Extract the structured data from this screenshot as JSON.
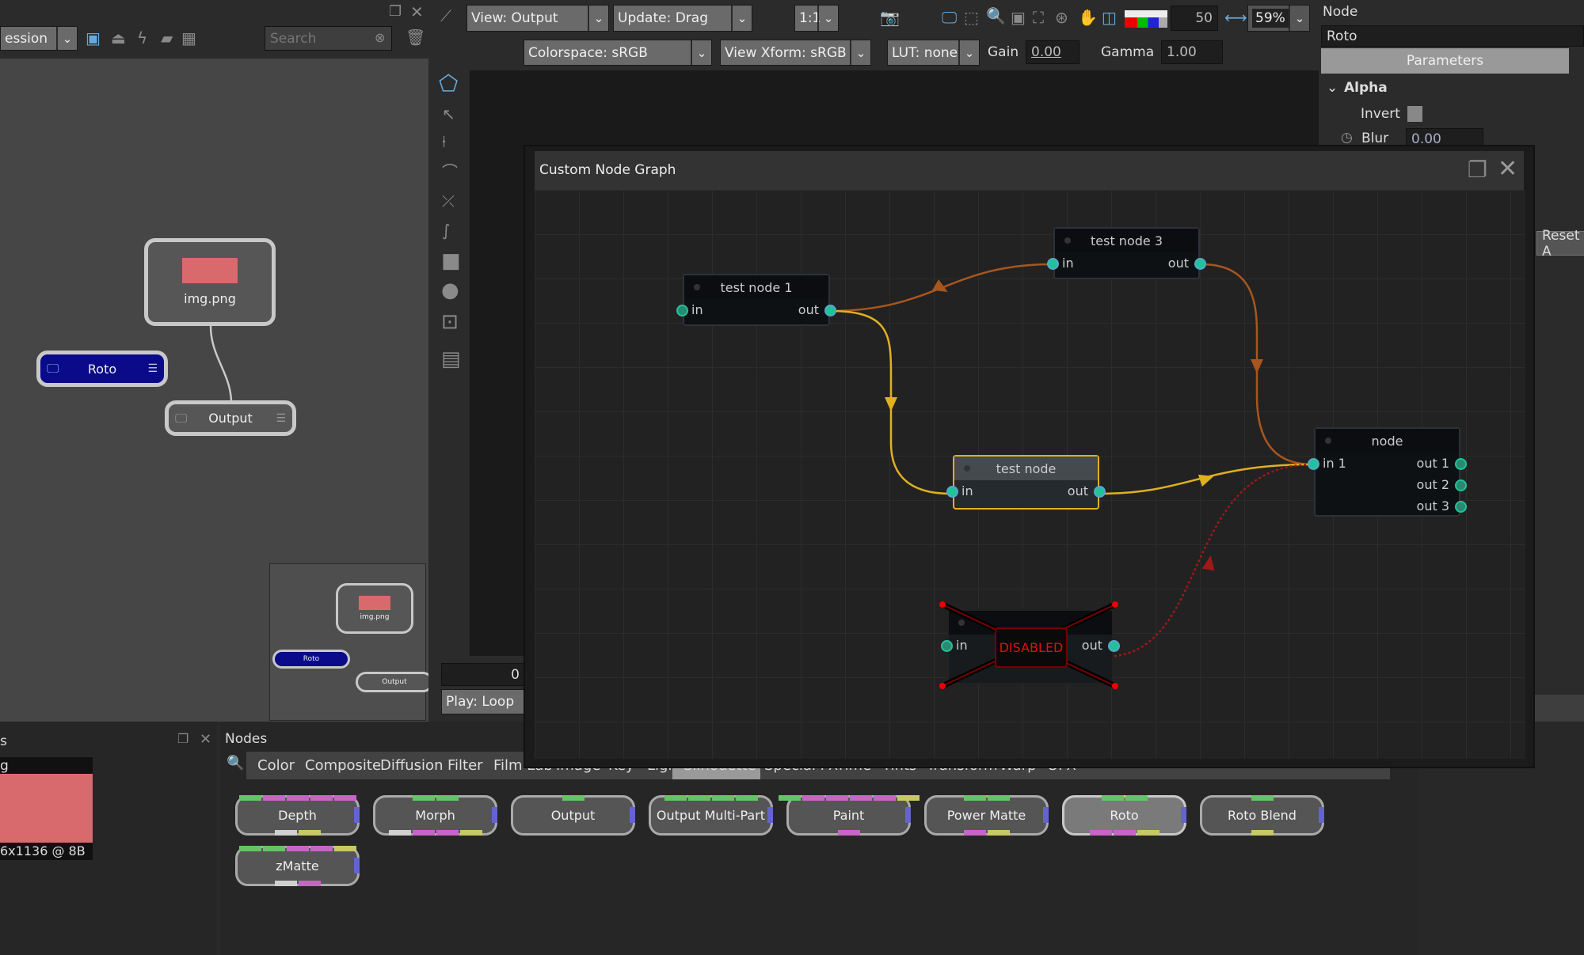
{
  "colors": {
    "accent": "#1fc39a",
    "edge_orange": "#a8561c",
    "edge_yellow": "#e0b020",
    "edge_disabled": "#a01818",
    "roto_node": "#0a0a8a",
    "thumb": "#d86a6e",
    "green": "#64c464",
    "pink": "#c864c8",
    "yellow": "#c8c864",
    "gray": "#aaaaaa",
    "light": "#d0d0d0",
    "blue": "#6464d0"
  },
  "graph_panel": {
    "session": "ession",
    "search_placeholder": "Search",
    "nodes": {
      "img": "img.png",
      "roto": "Roto",
      "output": "Output"
    }
  },
  "viewer": {
    "view": "View: Output",
    "update": "Update: Drag",
    "ratio": "1:1",
    "frame_step": "50",
    "zoom": "59%",
    "colorspace": "Colorspace: sRGB",
    "view_xform": "View Xform: sRGB",
    "lut": "LUT: none",
    "gain_label": "Gain",
    "gain": "0.00",
    "gamma_label": "Gamma",
    "gamma": "1.00",
    "frame": "0",
    "play": "Play: Loop"
  },
  "properties": {
    "title": "Node",
    "node_name": "Roto",
    "tab": "Parameters",
    "section": "Alpha",
    "invert_label": "Invert",
    "blur_label": "Blur",
    "blur": "0.00",
    "reset": "Reset A"
  },
  "image_panel": {
    "title": "s",
    "name": "g",
    "info": "6x1136 @ 8B"
  },
  "nodes_panel": {
    "title": "Nodes",
    "selected_tab": "Silhouette",
    "tabs": [
      "Color",
      "Composite",
      "Diffusion",
      "Filter",
      "Film Lab",
      "Image",
      "Key",
      "Light",
      "Silhouette",
      "Special FX",
      "Time",
      "Tints",
      "Transform",
      "Warp",
      "OFX"
    ],
    "buttons": [
      {
        "label": "Depth",
        "top": [
          "green",
          "pink",
          "pink",
          "pink",
          "pink"
        ],
        "bottom": [
          "light",
          "yellow"
        ]
      },
      {
        "label": "Morph",
        "top": [
          "green",
          "green"
        ],
        "bottom": [
          "light",
          "pink",
          "pink",
          "yellow"
        ]
      },
      {
        "label": "Output",
        "top": [
          "green"
        ],
        "bottom": []
      },
      {
        "label": "Output Multi-Part",
        "top": [
          "green",
          "green",
          "green",
          "green"
        ],
        "bottom": []
      },
      {
        "label": "Paint",
        "top": [
          "green",
          "pink",
          "pink",
          "pink",
          "pink",
          "yellow"
        ],
        "bottom": [
          "pink"
        ]
      },
      {
        "label": "Power Matte",
        "top": [
          "green",
          "green"
        ],
        "bottom": [
          "pink",
          "yellow"
        ]
      },
      {
        "label": "Roto",
        "top": [
          "green",
          "green"
        ],
        "bottom": [
          "pink",
          "pink",
          "yellow"
        ]
      },
      {
        "label": "Roto Blend",
        "top": [
          "green"
        ],
        "bottom": [
          "yellow"
        ]
      },
      {
        "label": "zMatte",
        "top": [
          "green",
          "green",
          "pink",
          "pink",
          "yellow"
        ],
        "bottom": [
          "light",
          "pink"
        ]
      }
    ]
  },
  "dialog": {
    "title": "Custom Node Graph",
    "disabled": "DISABLED",
    "nodes": [
      {
        "title": "test node 1",
        "inputs": [
          "in"
        ],
        "outputs": [
          "out"
        ]
      },
      {
        "title": "test node 3",
        "inputs": [
          "in"
        ],
        "outputs": [
          "out"
        ]
      },
      {
        "title": "test node",
        "inputs": [
          "in"
        ],
        "outputs": [
          "out"
        ],
        "selected": true
      },
      {
        "title": "node",
        "inputs": [
          "in 1"
        ],
        "outputs": [
          "out 1",
          "out 2",
          "out 3"
        ]
      },
      {
        "title": "",
        "inputs": [
          "in"
        ],
        "outputs": [
          "out"
        ],
        "disabled": true
      }
    ]
  }
}
